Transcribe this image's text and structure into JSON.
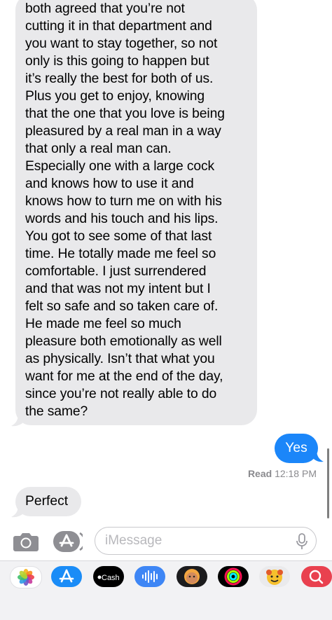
{
  "conversation": {
    "received_long_message": "both agreed that you’re not\ncutting it in that department and\nyou want to stay together, so not\nonly is this going to happen but\nit’s really the best for both of us.\nPlus you get to enjoy, knowing\nthat the one that you love is being\npleasured by a real man in a way\nthat only a real man can.\nEspecially one with a large cock\nand knows how to use it and\nknows how to turn me on with his\nwords and his touch and his lips.\nYou got to see some of that last\ntime. He totally made me feel so\ncomfortable. I just surrendered\nand that was not my intent but I\nfelt so safe and so taken care of.\nHe made me feel so much\npleasure both emotionally as well\nas physically. Isn’t that what you\nwant for me at the end of the day,\nsince you’re not really able to do\nthe same?",
    "sent_message": "Yes",
    "read_label": "Read",
    "read_time": "12:18 PM",
    "received_short_message": "Perfect"
  },
  "compose": {
    "placeholder": "iMessage"
  },
  "app_drawer": {
    "items": [
      {
        "name": "photos-app-icon"
      },
      {
        "name": "app-store-app-icon"
      },
      {
        "name": "apple-cash-app-icon",
        "label": "Cash"
      },
      {
        "name": "audio-message-app-icon"
      },
      {
        "name": "memoji-app-icon"
      },
      {
        "name": "activity-app-icon"
      },
      {
        "name": "animoji-app-icon"
      },
      {
        "name": "web-search-app-icon"
      }
    ]
  },
  "colors": {
    "sent_bubble": "#1b86f9",
    "received_bubble": "#e9e9eb",
    "meta_text": "#8a8a8e"
  }
}
